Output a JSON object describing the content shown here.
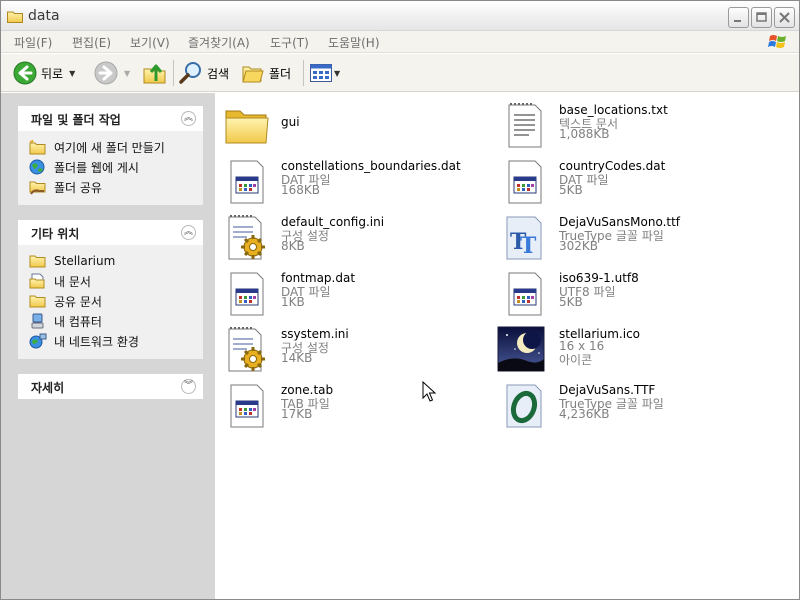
{
  "window": {
    "title": "data"
  },
  "menubar": {
    "items": [
      "파일(F)",
      "편집(E)",
      "보기(V)",
      "즐겨찾기(A)",
      "도구(T)",
      "도움말(H)"
    ]
  },
  "toolbar": {
    "back_label": "뒤로",
    "search_label": "검색",
    "folders_label": "폴더"
  },
  "taskpane": {
    "file_tasks": {
      "title": "파일 및 폴더 작업",
      "items": [
        "여기에 새 폴더 만들기",
        "폴더를 웹에 게시",
        "폴더 공유"
      ]
    },
    "other_places": {
      "title": "기타 위치",
      "items": [
        "Stellarium",
        "내 문서",
        "공유 문서",
        "내 컴퓨터",
        "내 네트워크 환경"
      ]
    },
    "details": {
      "title": "자세히"
    }
  },
  "files": [
    {
      "name": "gui",
      "type": "",
      "size": "",
      "icon": "folder-icon"
    },
    {
      "name": "base_locations.txt",
      "type": "텍스트 문서",
      "size": "1,088KB",
      "icon": "text-file-icon"
    },
    {
      "name": "constellations_boundaries.dat",
      "type": "DAT 파일",
      "size": "168KB",
      "icon": "dat-file-icon"
    },
    {
      "name": "countryCodes.dat",
      "type": "DAT 파일",
      "size": "5KB",
      "icon": "dat-file-icon"
    },
    {
      "name": "default_config.ini",
      "type": "구성 설정",
      "size": "8KB",
      "icon": "config-file-icon"
    },
    {
      "name": "DejaVuSansMono.ttf",
      "type": "TrueType 글꼴 파일",
      "size": "302KB",
      "icon": "truetype-font-icon"
    },
    {
      "name": "fontmap.dat",
      "type": "DAT 파일",
      "size": "1KB",
      "icon": "dat-file-icon"
    },
    {
      "name": "iso639-1.utf8",
      "type": "UTF8 파일",
      "size": "5KB",
      "icon": "utf8-file-icon"
    },
    {
      "name": "ssystem.ini",
      "type": "구성 설정",
      "size": "14KB",
      "icon": "config-file-icon"
    },
    {
      "name": "stellarium.ico",
      "type": "16 x 16",
      "size": "아이콘",
      "icon": "stellarium-icon"
    },
    {
      "name": "zone.tab",
      "type": "TAB 파일",
      "size": "17KB",
      "icon": "tab-file-icon"
    },
    {
      "name": "DejaVuSans.TTF",
      "type": "TrueType 글꼴 파일",
      "size": "4,236KB",
      "icon": "opentype-font-icon"
    }
  ]
}
